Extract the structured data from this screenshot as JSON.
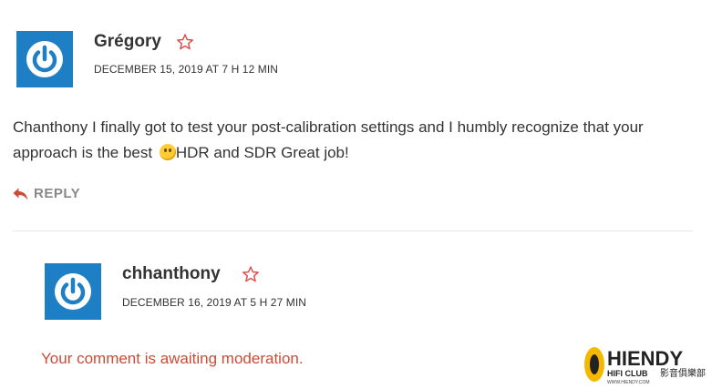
{
  "comments": [
    {
      "author": "Grégory",
      "date": "DECEMBER 15, 2019 AT 7 H 12 MIN",
      "text_before_emoji": "Chanthony I finally got to test your post-calibration settings and I humbly recognize that your approach is the best ",
      "emoji": "slightly-smiling-face",
      "text_after_emoji": "HDR and SDR Great job!",
      "reply_label": "REPLY"
    },
    {
      "author": "chhanthony",
      "date": "DECEMBER 16, 2019 AT 5 H 27 MIN",
      "moderation_notice": "Your comment is awaiting moderation."
    }
  ],
  "watermark": {
    "brand": "HIENDY",
    "subtitle": "HIFI CLUB",
    "chinese": "影音俱樂部",
    "url": "WWW.HIENDY.COM"
  },
  "colors": {
    "avatar_bg": "#1e7fc4",
    "star": "#d9534f",
    "moderation_text": "#cc4b37",
    "reply_icon": "#cc4b37",
    "watermark_yellow": "#f5b800"
  }
}
